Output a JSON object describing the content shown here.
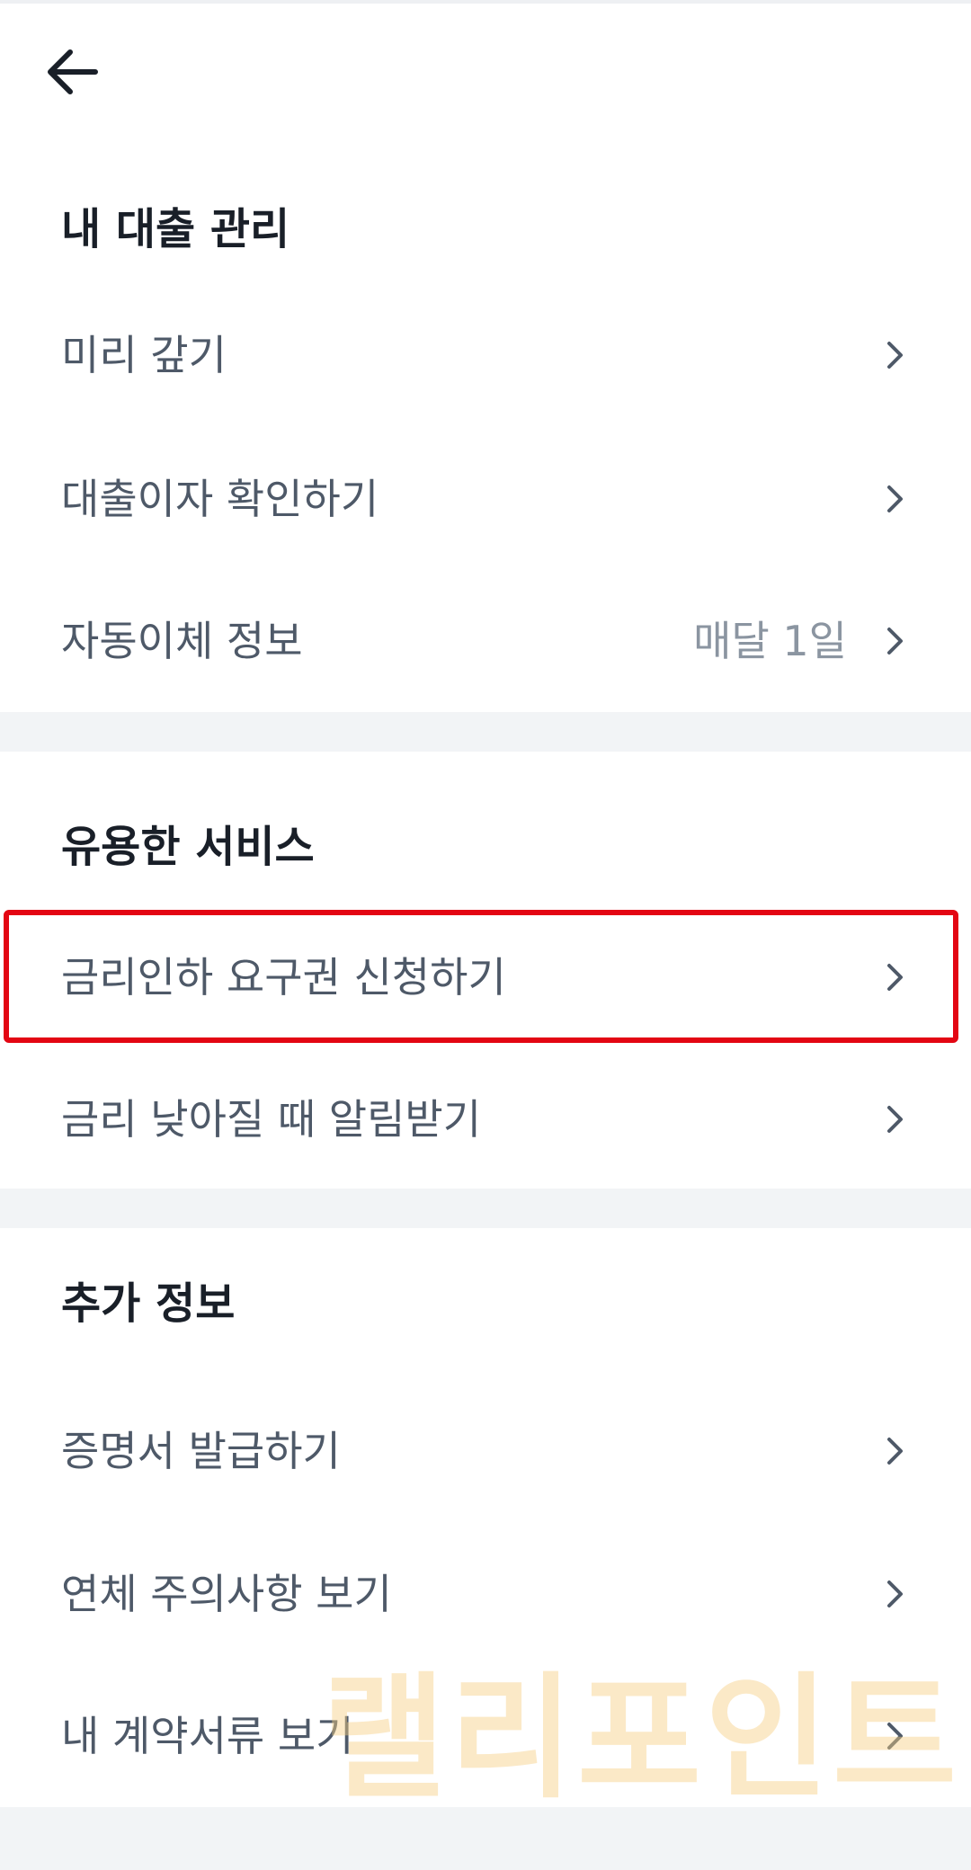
{
  "header": {
    "back_icon": "arrow-left-icon"
  },
  "sections": [
    {
      "title": "내 대출 관리",
      "items": [
        {
          "label": "미리 갚기",
          "value": ""
        },
        {
          "label": "대출이자 확인하기",
          "value": ""
        },
        {
          "label": "자동이체 정보",
          "value": "매달 1일"
        }
      ]
    },
    {
      "title": "유용한 서비스",
      "items": [
        {
          "label": "금리인하 요구권 신청하기",
          "value": "",
          "highlighted": true
        },
        {
          "label": "금리 낮아질 때 알림받기",
          "value": ""
        }
      ]
    },
    {
      "title": "추가 정보",
      "items": [
        {
          "label": "증명서 발급하기",
          "value": ""
        },
        {
          "label": "연체 주의사항 보기",
          "value": ""
        },
        {
          "label": "내 계약서류 보기",
          "value": ""
        }
      ]
    }
  ],
  "watermark": {
    "text": "랠리포인트"
  },
  "colors": {
    "title": "#191f28",
    "label": "#4e5968",
    "value": "#8b95a1",
    "chevron": "#4e5968",
    "divider": "#f2f4f6",
    "highlight": "#e30613",
    "watermark": "#f6ce82"
  }
}
